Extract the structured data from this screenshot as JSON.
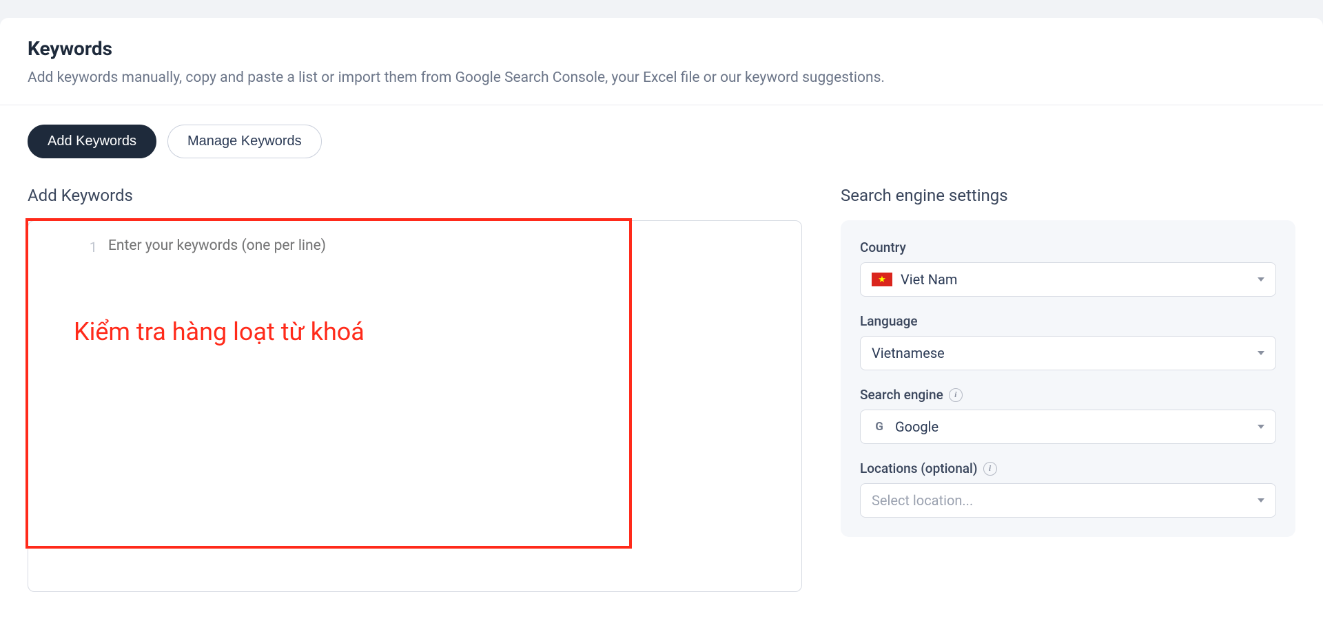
{
  "header": {
    "title": "Keywords",
    "subtitle": "Add keywords manually, copy and paste a list or import them from Google Search Console, your Excel file or our keyword suggestions."
  },
  "tabs": {
    "add": "Add Keywords",
    "manage": "Manage Keywords"
  },
  "left": {
    "heading": "Add Keywords",
    "line_number": "1",
    "placeholder": "Enter your keywords (one per line)"
  },
  "annotation": {
    "text": "Kiểm tra hàng loạt từ khoá"
  },
  "right": {
    "heading": "Search engine settings",
    "country": {
      "label": "Country",
      "value": "Viet Nam"
    },
    "language": {
      "label": "Language",
      "value": "Vietnamese"
    },
    "search_engine": {
      "label": "Search engine",
      "value": "Google"
    },
    "locations": {
      "label": "Locations (optional)",
      "placeholder": "Select location..."
    }
  }
}
